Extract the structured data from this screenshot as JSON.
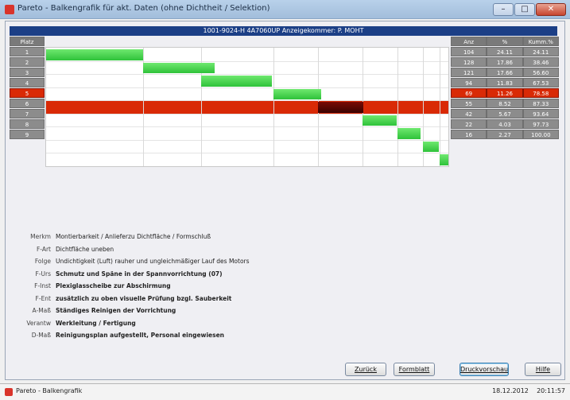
{
  "window": {
    "title": "Pareto - Balkengrafik für akt. Daten (ohne Dichtheit / Selektion)",
    "minimize": "–",
    "maximize": "□",
    "close": "✕"
  },
  "chart_header": "1001-9024-H 4A7060UP Anzeigekommer: P. MOHT",
  "left_column": {
    "header": "Platz",
    "rows": [
      "1",
      "2",
      "3",
      "4",
      "5",
      "6",
      "7",
      "8",
      "9"
    ],
    "highlight_index": 4
  },
  "right_table": {
    "headers": [
      "Anz",
      "%",
      "Kumm.%"
    ],
    "rows": [
      [
        "104",
        "24.11",
        "24.11"
      ],
      [
        "128",
        "17.86",
        "38.46"
      ],
      [
        "121",
        "17.66",
        "56.60"
      ],
      [
        "94",
        "11.83",
        "67.53"
      ],
      [
        "69",
        "11.26",
        "78.58"
      ],
      [
        "55",
        "8.52",
        "87.33"
      ],
      [
        "42",
        "5.67",
        "93.64"
      ],
      [
        "22",
        "4.03",
        "97.73"
      ],
      [
        "16",
        "2.27",
        "100.00"
      ]
    ],
    "highlight_index": 4
  },
  "chart_data": {
    "type": "bar",
    "orientation": "horizontal-cascade",
    "categories": [
      "1",
      "2",
      "3",
      "4",
      "5",
      "6",
      "7",
      "8",
      "9"
    ],
    "values": [
      24.11,
      17.86,
      17.66,
      11.83,
      11.26,
      8.52,
      5.67,
      4.03,
      2.27
    ],
    "cumulative": [
      24.11,
      38.46,
      56.6,
      67.53,
      78.58,
      87.33,
      93.64,
      97.73,
      100.0
    ],
    "highlight_index": 4,
    "bar_color": "#3ccc46",
    "highlight_color": "#5a0502",
    "highlight_row_color": "#d92a06"
  },
  "info": [
    {
      "label": "Merkm",
      "value": "Montierbarkeit / Anlieferzu Dichtfläche / Formschluß",
      "bold": false
    },
    {
      "label": "F-Art",
      "value": "Dichtfläche uneben",
      "bold": false
    },
    {
      "label": "Folge",
      "value": "Undichtigkeit (Luft) rauher und ungleichmäßiger Lauf des Motors",
      "bold": false
    },
    {
      "label": "F-Urs",
      "value": "Schmutz und Späne in der Spannvorrichtung (07)",
      "bold": true
    },
    {
      "label": "F-Inst",
      "value": "Plexiglasscheibe zur Abschirmung",
      "bold": true
    },
    {
      "label": "F-Ent",
      "value": "zusätzlich zu oben visuelle Prüfung bzgl. Sauberkeit",
      "bold": true
    },
    {
      "label": "A-Maß",
      "value": "Ständiges Reinigen der Vorrichtung",
      "bold": true
    },
    {
      "label": "Verantw",
      "value": "Werkleitung / Fertigung",
      "bold": true
    },
    {
      "label": "D-Maß",
      "value": "Reinigungsplan aufgestellt, Personal eingewiesen",
      "bold": true
    }
  ],
  "buttons": {
    "back": "Zurück",
    "format": "Formblatt",
    "print_preview": "Druckvorschau",
    "help": "Hilfe"
  },
  "statusbar": {
    "app": "Pareto - Balkengrafik",
    "date": "18.12.2012",
    "time": "20:11:57"
  }
}
